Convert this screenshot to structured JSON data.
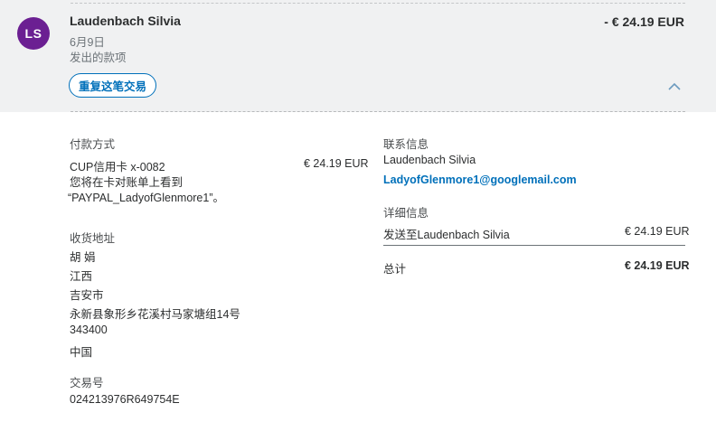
{
  "header": {
    "avatar_initials": "LS",
    "name": "Laudenbach Silvia",
    "date": "6月9日",
    "type": "发出的款项",
    "amount": "- € 24.19 EUR",
    "repeat_button": "重复这笔交易"
  },
  "payment": {
    "section_title": "付款方式",
    "method": "CUP信用卡 x-0082",
    "method_amount": "€ 24.19 EUR",
    "note_line1": "您将在卡对账单上看到",
    "note_line2": "“PAYPAL_LadyofGlenmore1”。"
  },
  "shipping": {
    "section_title": "收货地址",
    "lines": [
      "胡 娟",
      "江西",
      "吉安市",
      "永新县象形乡花溪村马家塘组14号",
      "343400",
      "中国"
    ]
  },
  "transaction": {
    "section_title": "交易号",
    "id": "024213976R649754E"
  },
  "contact": {
    "section_title": "联系信息",
    "name": "Laudenbach Silvia",
    "email": "LadyofGlenmore1@googlemail.com"
  },
  "details": {
    "section_title": "详细信息",
    "sent_label": "发送至Laudenbach Silvia",
    "sent_amount": "€ 24.19 EUR",
    "total_label": "总计",
    "total_amount": "€ 24.19 EUR"
  },
  "colors": {
    "accent": "#0070ba",
    "avatar": "#6b1f92",
    "header_bg": "#f0f1f2"
  }
}
